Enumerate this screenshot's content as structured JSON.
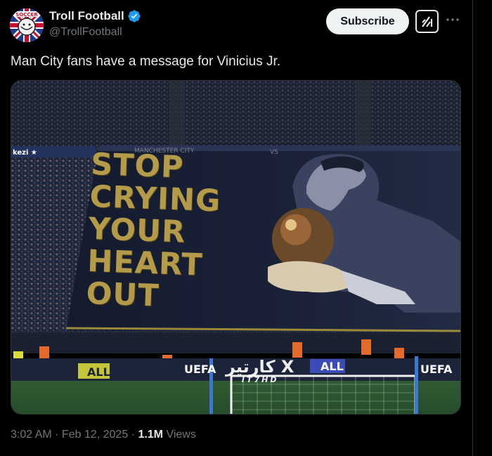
{
  "account": {
    "display_name": "Troll Football",
    "handle": "@TrollFootball",
    "avatar_icon": "troll-football-logo",
    "verified_color": "#1d9bf0"
  },
  "actions": {
    "subscribe_label": "Subscribe",
    "grok_icon": "grok-icon",
    "more_icon": "more-dots-icon"
  },
  "tweet": {
    "text": "Man City fans have a message for Vinicius Jr."
  },
  "media": {
    "banner_lines": [
      "STOP",
      "CRYING",
      "YOUR",
      "HEART",
      "OUT"
    ],
    "banner_top_left": "MANCHESTER CITY",
    "banner_top_vs": "VS",
    "board_left_ad": "ALL",
    "board_uefa_1": "UEFA",
    "board_right_ad": "ALL",
    "board_uefa_2": "UEFA",
    "watermark_main": "كارتير X",
    "watermark_sub": "IT7HD",
    "corner_ad": "kezi"
  },
  "meta": {
    "time": "3:02 AM",
    "separator": " · ",
    "date": "Feb 12, 2025",
    "views_count": "1.1M",
    "views_label": " Views"
  },
  "colors": {
    "background": "#000000",
    "text_primary": "#e7e9ea",
    "text_secondary": "#71767b",
    "subscribe_bg": "#eff3f4",
    "banner_gold": "#b39b4a"
  }
}
